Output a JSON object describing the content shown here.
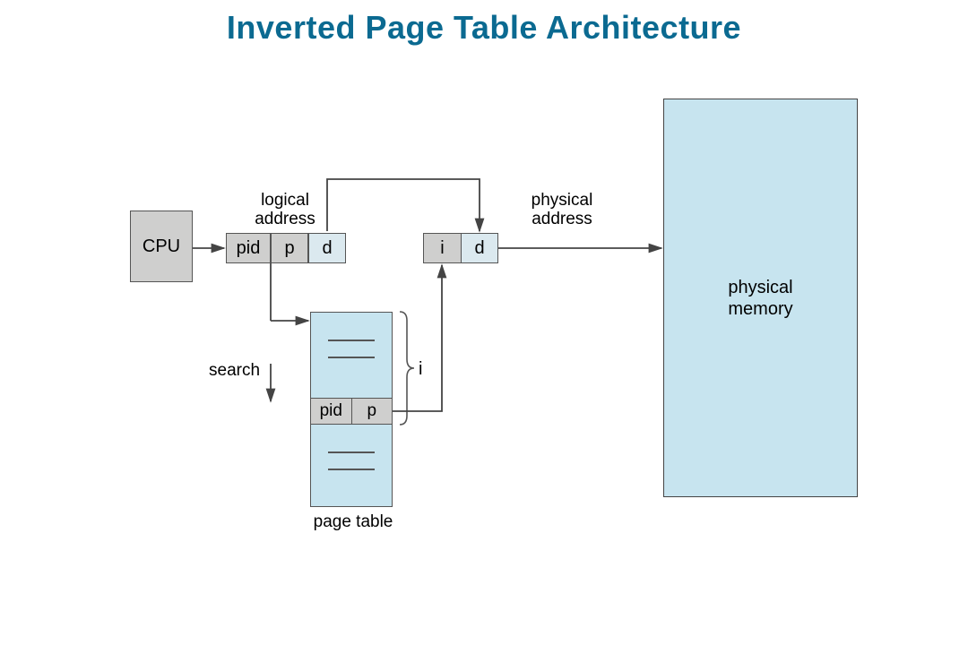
{
  "title": "Inverted Page Table Architecture",
  "cpu": "CPU",
  "logical_address_label": "logical\naddress",
  "la": {
    "pid": "pid",
    "p": "p",
    "d": "d"
  },
  "physical_address_label": "physical\naddress",
  "pa": {
    "i": "i",
    "d": "d"
  },
  "search_label": "search",
  "page_table_label": "page table",
  "pt_row": {
    "pid": "pid",
    "p": "p"
  },
  "brace_label": "i",
  "phys_mem": "physical\nmemory"
}
